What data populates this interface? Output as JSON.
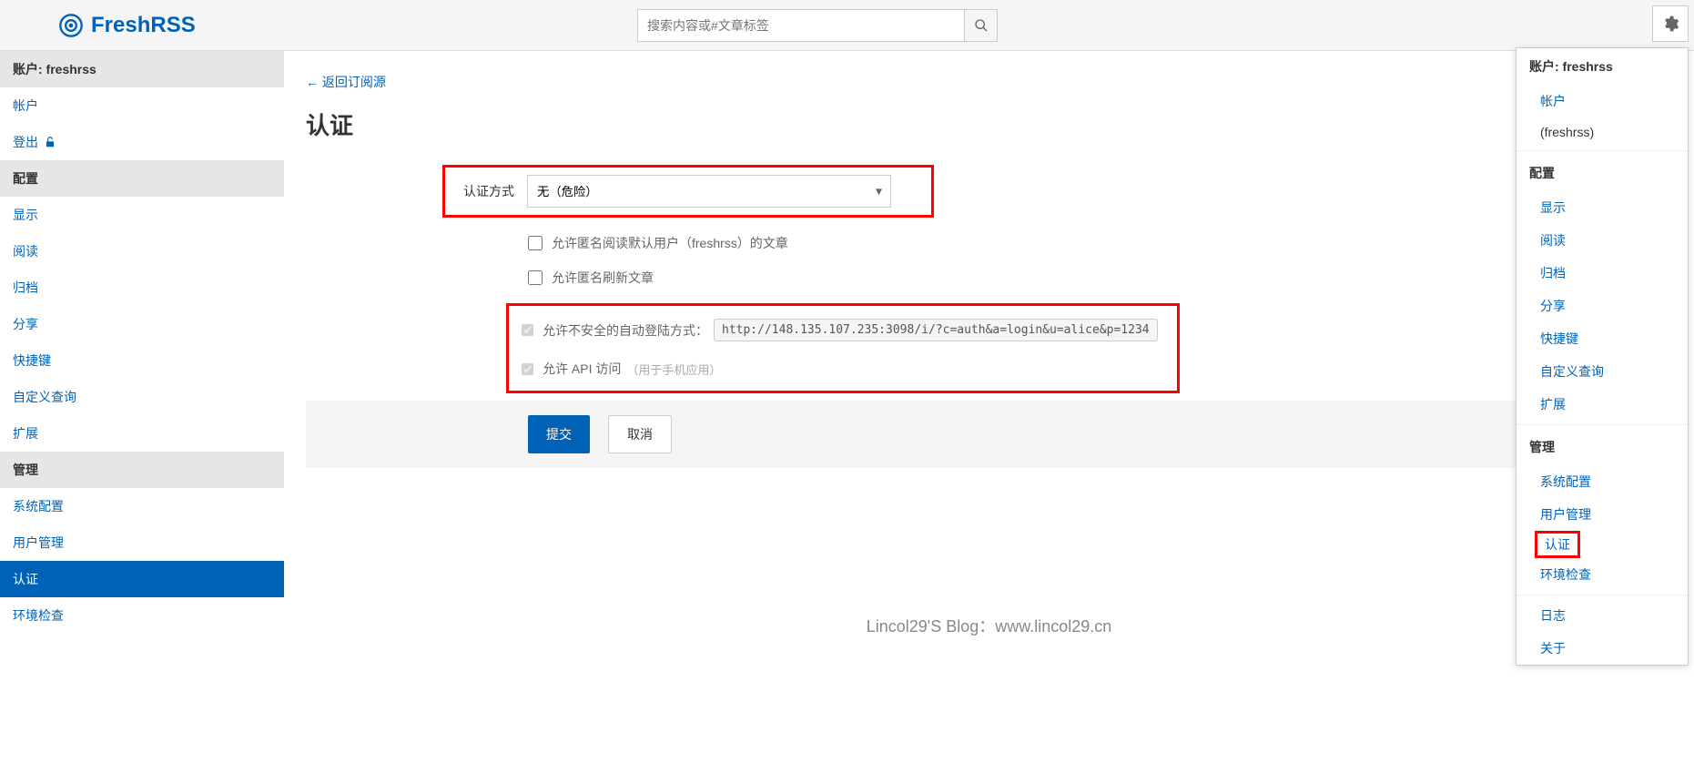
{
  "app": {
    "name": "FreshRSS"
  },
  "search": {
    "placeholder": "搜索内容或#文章标签"
  },
  "sidebar": {
    "account_header": "账户: freshrss",
    "account_link": "帐户",
    "logout": "登出",
    "config_header": "配置",
    "display": "显示",
    "reading": "阅读",
    "archive": "归档",
    "share": "分享",
    "shortcuts": "快捷键",
    "custom_query": "自定义查询",
    "extensions": "扩展",
    "admin_header": "管理",
    "system_config": "系统配置",
    "user_manage": "用户管理",
    "auth": "认证",
    "env_check": "环境检查"
  },
  "main": {
    "back": "← 返回订阅源",
    "title": "认证",
    "auth_method_label": "认证方式",
    "auth_method_value": "无（危险）",
    "anon_read": "允许匿名阅读默认用户（freshrss）的文章",
    "anon_refresh": "允许匿名刷新文章",
    "unsafe_login": "允许不安全的自动登陆方式：",
    "unsafe_login_kbd": "http://148.135.107.235:3098/i/?c=auth&a=login&u=alice&p=1234",
    "api_access": "允许 API 访问",
    "api_note": "（用于手机应用）",
    "submit": "提交",
    "cancel": "取消"
  },
  "watermark": "Lincol29'S Blog：www.lincol29.cn",
  "dropdown": {
    "account_header": "账户: freshrss",
    "account": "帐户",
    "username": "(freshrss)",
    "config_header": "配置",
    "display": "显示",
    "reading": "阅读",
    "archive": "归档",
    "share": "分享",
    "shortcuts": "快捷键",
    "custom_query": "自定义查询",
    "extensions": "扩展",
    "admin_header": "管理",
    "system_config": "系统配置",
    "user_manage": "用户管理",
    "auth": "认证",
    "env_check": "环境检查",
    "logs": "日志",
    "about": "关于"
  }
}
